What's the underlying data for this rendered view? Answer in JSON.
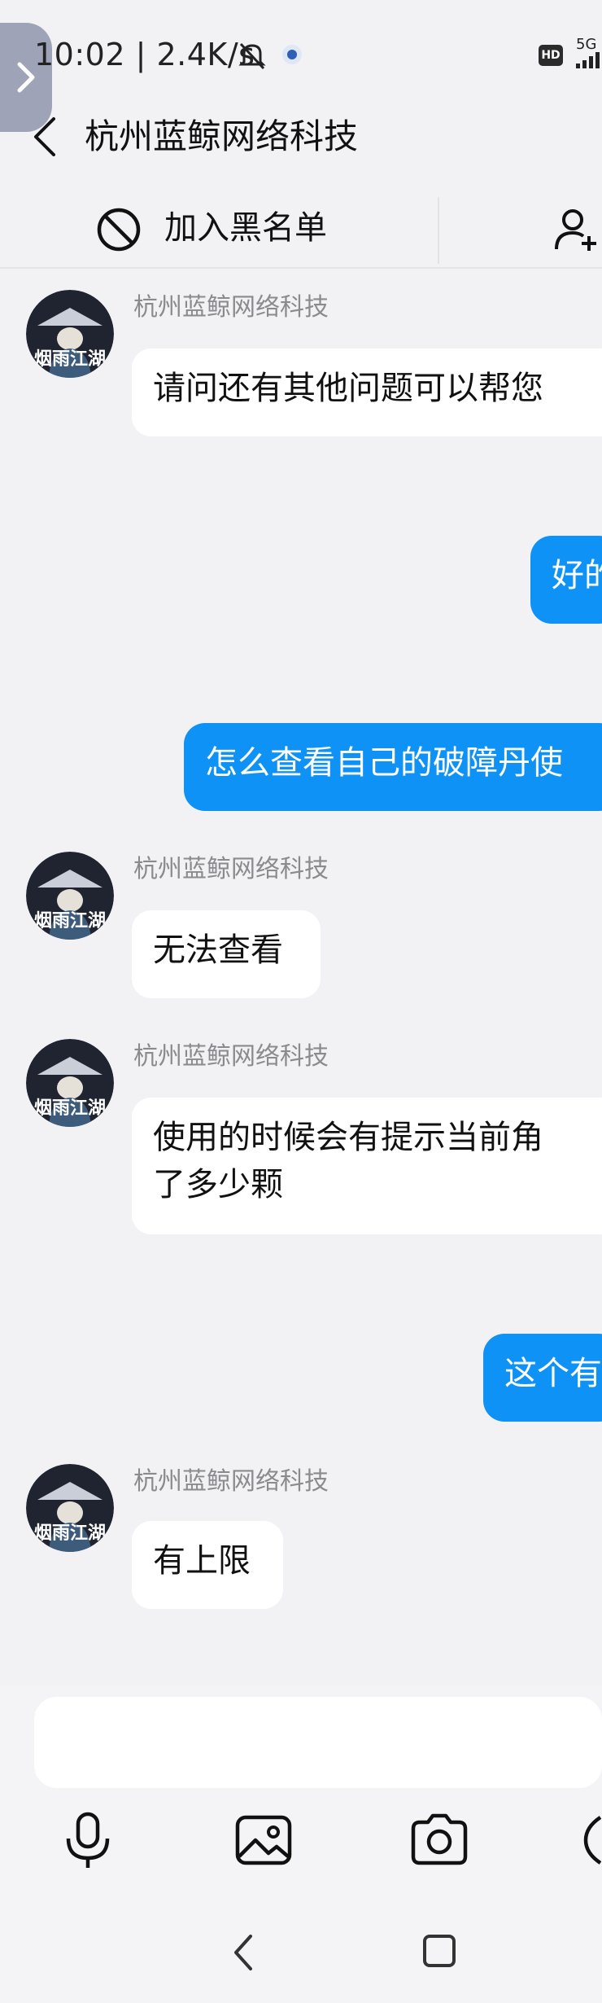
{
  "status_bar": {
    "time_speed": "10:02 | 2.4K/s",
    "hd_label": "HD",
    "network_label": "5G"
  },
  "header": {
    "title": "杭州蓝鲸网络科技"
  },
  "action_bar": {
    "block_label": "加入黑名单",
    "add_friend_icon": "add-user-icon"
  },
  "messages": [
    {
      "direction": "in",
      "sender": "杭州蓝鲸网络科技",
      "lines": [
        "请问还有其他问题可以帮您"
      ]
    },
    {
      "direction": "out",
      "lines": [
        "好的"
      ]
    },
    {
      "direction": "out",
      "lines": [
        "怎么查看自己的破障丹使"
      ]
    },
    {
      "direction": "in",
      "sender": "杭州蓝鲸网络科技",
      "lines": [
        "无法查看"
      ]
    },
    {
      "direction": "in",
      "sender": "杭州蓝鲸网络科技",
      "lines": [
        "使用的时候会有提示当前角",
        "了多少颗"
      ]
    },
    {
      "direction": "out",
      "lines": [
        "这个有"
      ]
    },
    {
      "direction": "in",
      "sender": "杭州蓝鲸网络科技",
      "lines": [
        "有上限"
      ]
    }
  ],
  "avatar_text": "烟雨江湖",
  "toolbar": {
    "icons": [
      "microphone-icon",
      "image-icon",
      "camera-icon",
      "emoji-icon"
    ]
  },
  "nav": {
    "icons": [
      "back-nav-icon",
      "home-nav-icon"
    ]
  },
  "colors": {
    "outgoing_bubble": "#0f92f5",
    "incoming_bubble": "#ffffff",
    "background": "#f2f2f5"
  }
}
